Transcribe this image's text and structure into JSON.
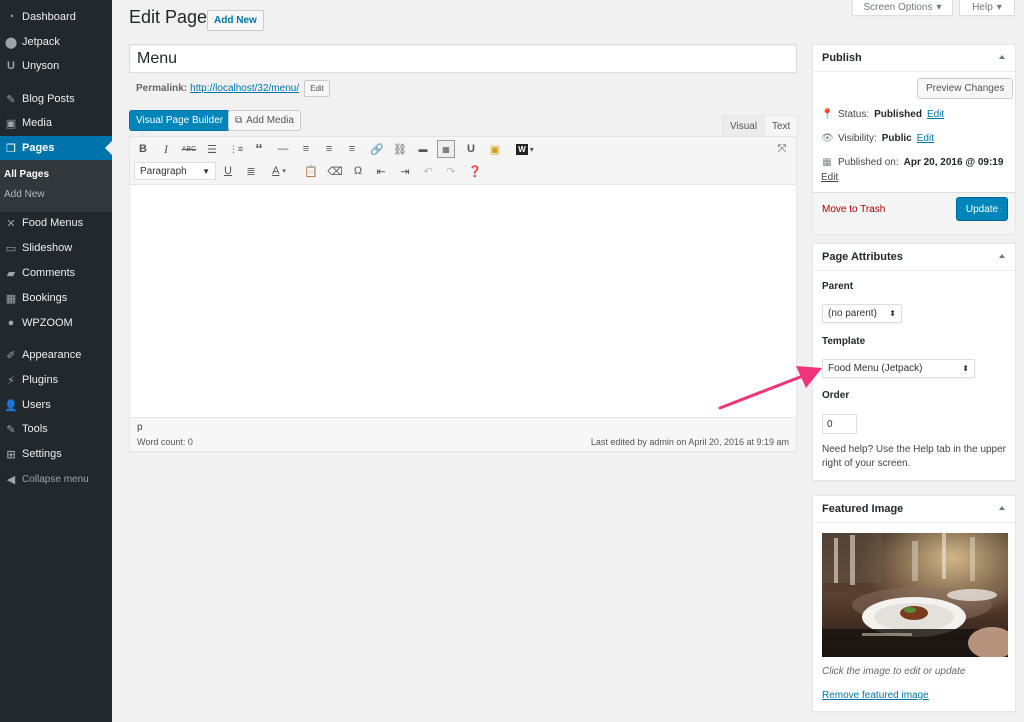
{
  "sidebar": {
    "items": [
      {
        "label": "Dashboard",
        "icon": "dashboard-icon"
      },
      {
        "label": "Jetpack",
        "icon": "jetpack-icon"
      },
      {
        "label": "Unyson",
        "icon": "unyson-icon"
      },
      {
        "label": "Blog Posts",
        "icon": "pin-icon"
      },
      {
        "label": "Media",
        "icon": "media-icon"
      },
      {
        "label": "Pages",
        "icon": "pages-icon"
      },
      {
        "label": "Food Menus",
        "icon": "utensils-icon"
      },
      {
        "label": "Slideshow",
        "icon": "slideshow-icon"
      },
      {
        "label": "Comments",
        "icon": "comment-icon"
      },
      {
        "label": "Bookings",
        "icon": "calendar-icon"
      },
      {
        "label": "WPZOOM",
        "icon": "wpzoom-icon"
      },
      {
        "label": "Appearance",
        "icon": "brush-icon"
      },
      {
        "label": "Plugins",
        "icon": "plugin-icon"
      },
      {
        "label": "Users",
        "icon": "users-icon"
      },
      {
        "label": "Tools",
        "icon": "wrench-icon"
      },
      {
        "label": "Settings",
        "icon": "settings-icon"
      }
    ],
    "submenu": [
      "All Pages",
      "Add New"
    ],
    "collapse_label": "Collapse menu"
  },
  "topbar": {
    "screen_options": "Screen Options",
    "help": "Help"
  },
  "header": {
    "title": "Edit Page",
    "add_new": "Add New"
  },
  "post": {
    "title": "Menu",
    "permalink_label": "Permalink:",
    "permalink_url": "http://localhost/32/menu/",
    "permalink_edit": "Edit"
  },
  "editor": {
    "visual_builder": "Visual Page Builder",
    "add_media": "Add Media",
    "tab_visual": "Visual",
    "tab_text": "Text",
    "format_select": "Paragraph",
    "path": "p",
    "word_count": "Word count: 0",
    "last_edited": "Last edited by admin on April 20, 2016 at 9:19 am"
  },
  "publish": {
    "title": "Publish",
    "preview": "Preview Changes",
    "status_label": "Status:",
    "status_value": "Published",
    "visibility_label": "Visibility:",
    "visibility_value": "Public",
    "published_label": "Published on:",
    "published_value": "Apr 20, 2016 @ 09:19",
    "edit": "Edit",
    "trash": "Move to Trash",
    "update": "Update"
  },
  "attributes": {
    "title": "Page Attributes",
    "parent_label": "Parent",
    "parent_value": "(no parent)",
    "template_label": "Template",
    "template_value": "Food Menu (Jetpack)",
    "order_label": "Order",
    "order_value": "0",
    "help_text": "Need help? Use the Help tab in the upper right of your screen."
  },
  "featured": {
    "title": "Featured Image",
    "caption": "Click the image to edit or update",
    "remove": "Remove featured image"
  },
  "colors": {
    "accent": "#0073aa",
    "sidebar": "#23282d",
    "arrow": "#f0347c"
  }
}
